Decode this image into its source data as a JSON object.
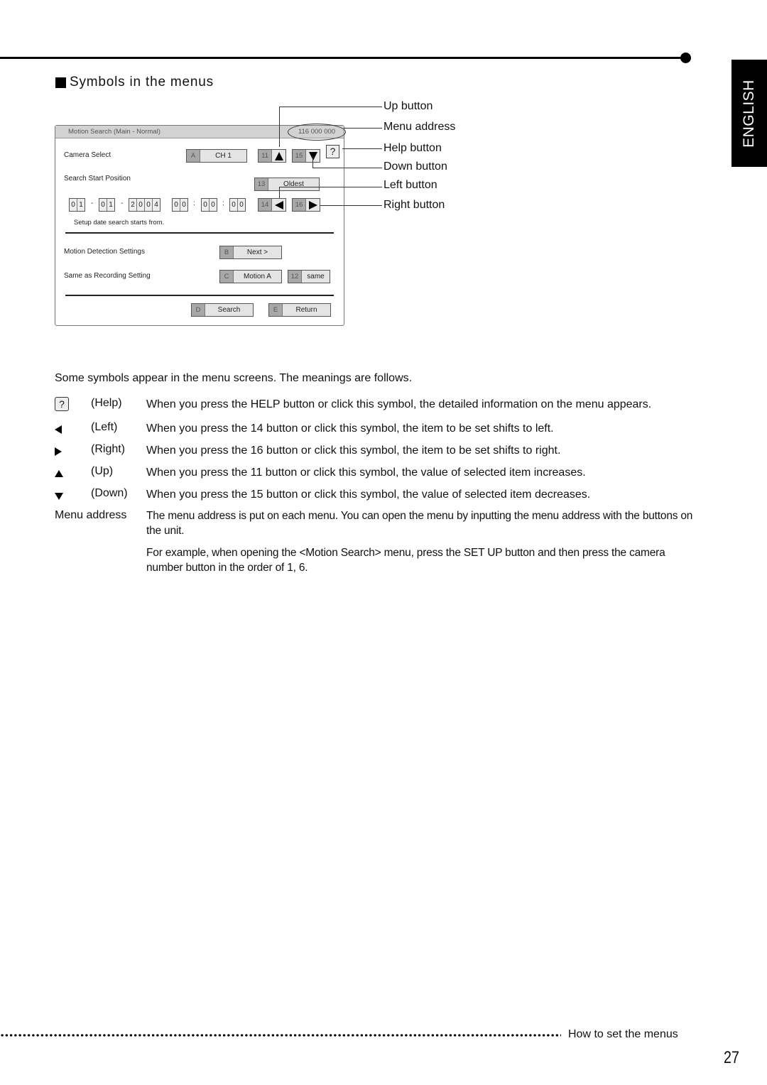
{
  "language_tab": "ENGLISH",
  "section_heading": "Symbols in the menus",
  "menu_screen": {
    "title": "Motion Search (Main - Normal)",
    "menu_address": "116 000 000",
    "help_symbol": "?",
    "camera_select": {
      "label": "Camera Select",
      "key": "A",
      "value": "CH 1"
    },
    "up_button": {
      "key": "11"
    },
    "down_button": {
      "key": "15"
    },
    "search_start": {
      "label": "Search Start Position",
      "key": "13",
      "value": "Oldest"
    },
    "left_button": {
      "key": "14"
    },
    "right_button": {
      "key": "16"
    },
    "date": {
      "day": [
        "0",
        "1"
      ],
      "month": [
        "0",
        "1"
      ],
      "year": [
        "2",
        "0",
        "0",
        "4"
      ],
      "sep": "-"
    },
    "time": {
      "hh": [
        "0",
        "0"
      ],
      "mm": [
        "0",
        "0"
      ],
      "ss": [
        "0",
        "0"
      ],
      "sep": ":"
    },
    "hint": "Setup date search starts from.",
    "motion_detection": {
      "label": "Motion Detection Settings",
      "key": "B",
      "value": "Next >"
    },
    "same_as_recording": {
      "label": "Same as Recording Setting",
      "key": "C",
      "value": "Motion A",
      "key2": "12",
      "value2": "same"
    },
    "search_button": {
      "key": "D",
      "value": "Search"
    },
    "return_button": {
      "key": "E",
      "value": "Return"
    }
  },
  "callouts": {
    "up": "Up button",
    "menu_address": "Menu address",
    "help": "Help button",
    "down": "Down button",
    "left": "Left button",
    "right": "Right button"
  },
  "intro": "Some symbols appear in the menu screens. The meanings are follows.",
  "symbols": [
    {
      "icon": "?",
      "name": "(Help)",
      "desc": "When you press the HELP button or click this symbol, the detailed information on the menu appears."
    },
    {
      "icon": "◀",
      "name": "(Left)",
      "desc": "When you press the 14 button or click this symbol, the item to be set shifts to left."
    },
    {
      "icon": "▶",
      "name": "(Right)",
      "desc": "When you press the 16 button or click this symbol, the item to be set shifts to right."
    },
    {
      "icon": "▲",
      "name": "(Up)",
      "desc": "When you press the 11 button or click this symbol, the value of selected item increases."
    },
    {
      "icon": "▼",
      "name": "(Down)",
      "desc": "When you press the 15 button or click this symbol, the value of selected item decreases."
    }
  ],
  "menu_address_section": {
    "label": "Menu address",
    "para1": "The menu address is put on each menu. You can open the menu by inputting the menu address with the buttons on the unit.",
    "para2": "For example, when opening the <Motion Search> menu, press the SET UP button and then press the camera number button in the order of 1, 6."
  },
  "footer": {
    "title": "How to set the menus",
    "page_number": "27"
  }
}
